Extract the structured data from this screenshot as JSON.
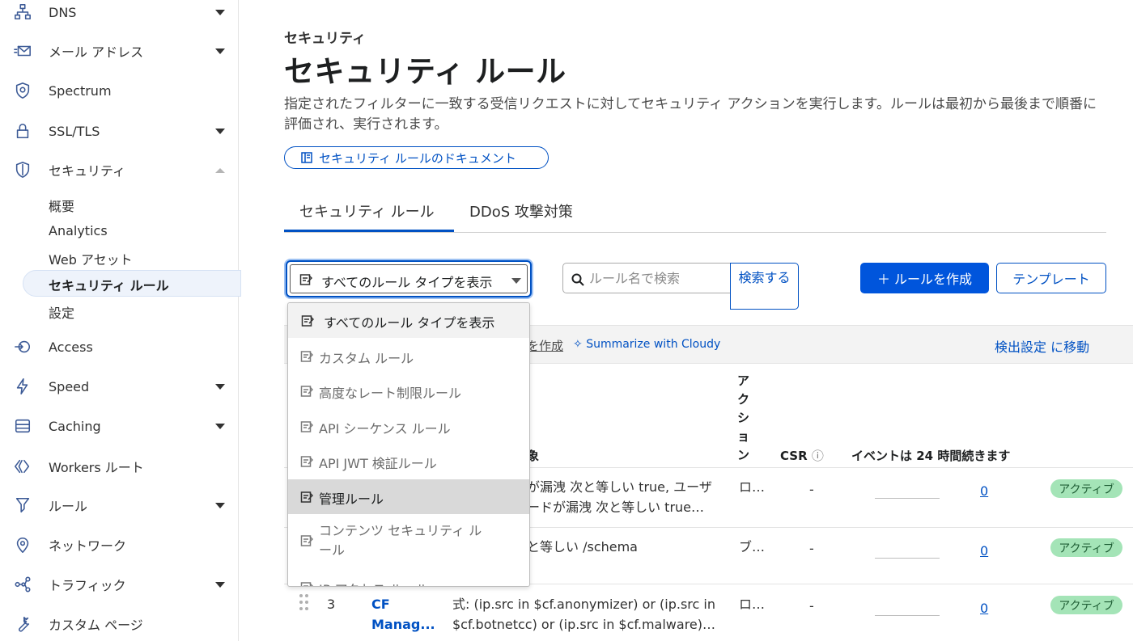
{
  "sidebar": {
    "items": [
      {
        "label": "DNS",
        "icon": "sitemap-icon",
        "caret": true
      },
      {
        "label": "メール アドレス",
        "icon": "email-icon",
        "caret": true
      },
      {
        "label": "Spectrum",
        "icon": "shield-cog-icon",
        "caret": false
      },
      {
        "label": "SSL/TLS",
        "icon": "lock-icon",
        "caret": true
      },
      {
        "label": "セキュリティ",
        "icon": "shield-icon",
        "caret": "up"
      },
      {
        "label": "Access",
        "icon": "access-icon",
        "caret": false
      },
      {
        "label": "Speed",
        "icon": "bolt-icon",
        "caret": true
      },
      {
        "label": "Caching",
        "icon": "storage-icon",
        "caret": true
      },
      {
        "label": "Workers ルート",
        "icon": "workers-icon",
        "caret": false
      },
      {
        "label": "ルール",
        "icon": "funnel-icon",
        "caret": true
      },
      {
        "label": "ネットワーク",
        "icon": "location-pin-icon",
        "caret": false
      },
      {
        "label": "トラフィック",
        "icon": "network-icon",
        "caret": true
      },
      {
        "label": "カスタム ページ",
        "icon": "wrench-icon",
        "caret": false
      }
    ],
    "security_sub": [
      "概要",
      "Analytics",
      "Web アセット",
      "セキュリティ ルール",
      "設定"
    ]
  },
  "header": {
    "breadcrumb": "セキュリティ",
    "title": "セキュリティ ルール",
    "description": "指定されたフィルターに一致する受信リクエストに対してセキュリティ アクションを実行します。ルールは最初から最後まで順番に評価され、実行されます。",
    "doc_link": "セキュリティ ルールのドキュメント"
  },
  "tabs": [
    "セキュリティ ルール",
    "DDoS 攻撃対策"
  ],
  "filter": {
    "selected": "すべてのルール タイプを表示",
    "options": [
      "すべてのルール タイプを表示",
      "カスタム ルール",
      "高度なレート制限ルール",
      "API シーケンス ルール",
      "API JWT 検証ルール",
      "管理ルール",
      "コンテンツ セキュリティ ルール",
      "IP アクセス ルール"
    ]
  },
  "search": {
    "placeholder": "ルール名で検索",
    "button": "検索する"
  },
  "actions": {
    "create": "＋ ルールを作成",
    "template": "テンプレート"
  },
  "toolbar": {
    "create_partial": "を作成",
    "cloudy": "Summarize with Cloudy",
    "detection": "検出設定 に移動"
  },
  "columns": {
    "match_partial": "象",
    "action": "アクション",
    "csr": "CSR",
    "events": "イベントは 24 時間続きます"
  },
  "rows": [
    {
      "num": "",
      "name1": "",
      "name2": "",
      "expr1": "が漏洩 次と等しい true, ユーザ",
      "expr2": "ードが漏洩 次と等しい true…",
      "action": "ロ…",
      "csr": "-",
      "count": "0",
      "status": "アクティブ"
    },
    {
      "num": "",
      "name1": "",
      "name2": "",
      "expr1": "と等しい /schema",
      "expr2": "",
      "action": "ブ…",
      "csr": "-",
      "count": "0",
      "status": "アクティブ"
    },
    {
      "num": "3",
      "name1": "CF",
      "name2": "Manag...",
      "expr1": "式: (ip.src in $cf.anonymizer) or (ip.src in",
      "expr2": "$cf.botnetcc) or (ip.src in $cf.malware)…",
      "action": "ロ…",
      "csr": "-",
      "count": "0",
      "status": "アクティブ"
    }
  ]
}
